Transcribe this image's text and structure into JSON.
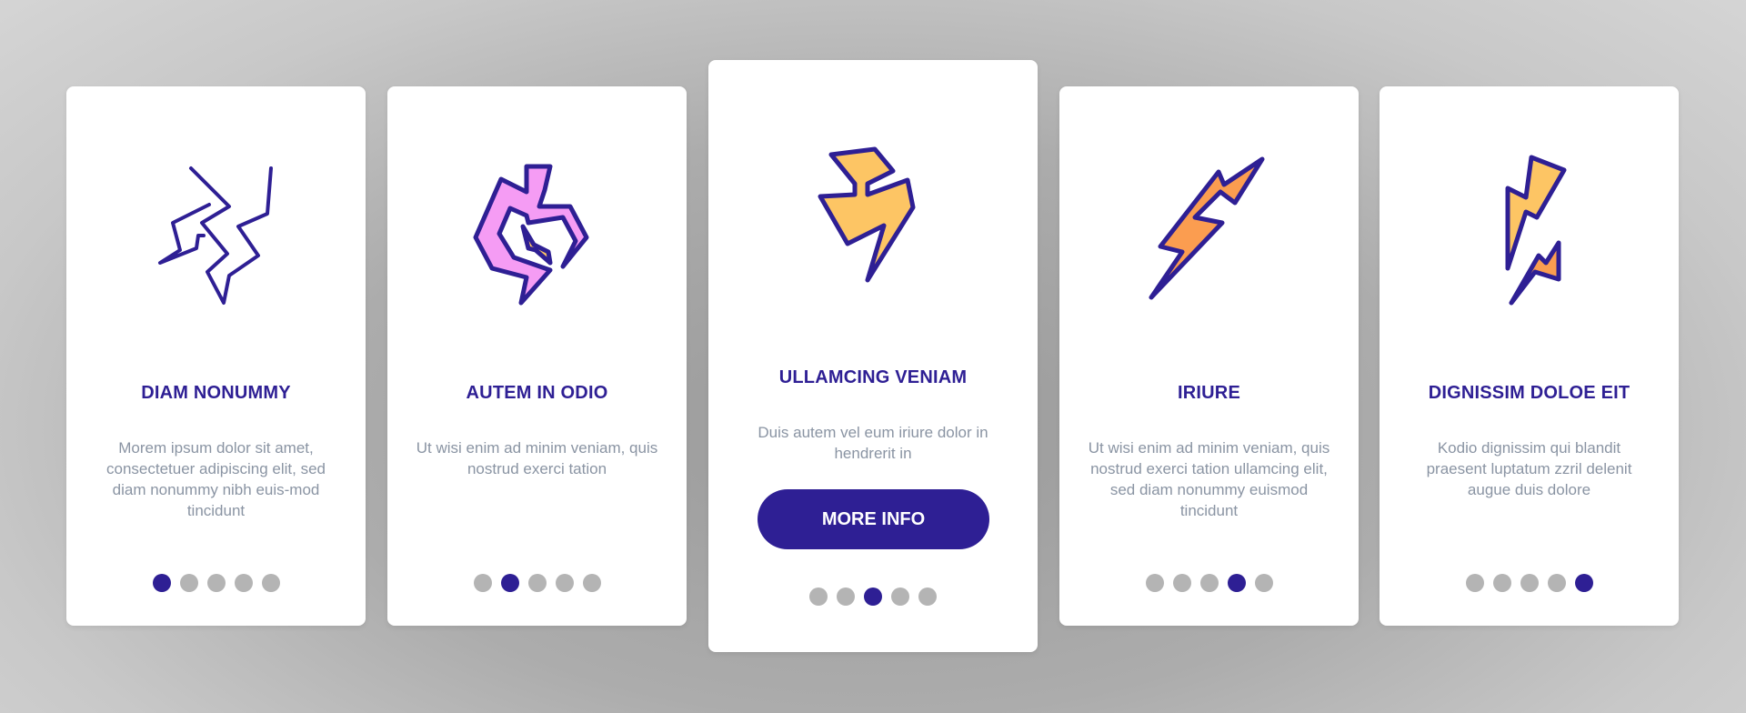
{
  "colors": {
    "accent": "#2e1f94",
    "dot_inactive": "#b4b4b4",
    "text_muted": "#8a94a3",
    "card_bg": "#ffffff",
    "icon_yellow": "#fdc564",
    "icon_orange": "#fb9d50",
    "icon_pink": "#f59cf4"
  },
  "cards": [
    {
      "icon": "lightning-outline-icon",
      "title": "DIAM NONUMMY",
      "description": "Morem ipsum dolor sit amet, consectetuer adipiscing elit, sed diam nonummy nibh euis-mod tincidunt",
      "active_dot": 1
    },
    {
      "icon": "circular-lightning-icon",
      "title": "AUTEM IN ODIO",
      "description": "Ut wisi enim ad minim veniam, quis nostrud exerci tation",
      "active_dot": 2
    },
    {
      "icon": "yellow-lightning-icon",
      "title": "ULLAMCING VENIAM",
      "description": "Duis autem vel eum iriure dolor in hendrerit in",
      "button_label": "MORE INFO",
      "active_dot": 3
    },
    {
      "icon": "orange-lightning-bolt-icon",
      "title": "IRIURE",
      "description": "Ut wisi enim ad minim veniam, quis nostrud exerci tation ullamcing elit, sed diam nonummy euismod tincidunt",
      "active_dot": 4
    },
    {
      "icon": "double-lightning-icon",
      "title": "DIGNISSIM DOLOE EIT",
      "description": "Kodio dignissim qui blandit praesent luptatum zzril delenit augue duis dolore",
      "active_dot": 5
    }
  ],
  "pagination": {
    "total": 5
  }
}
